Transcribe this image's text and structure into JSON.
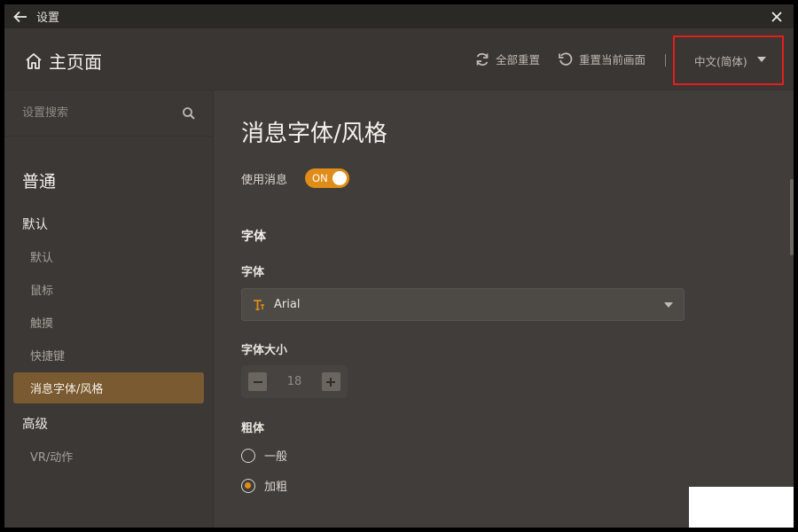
{
  "window": {
    "title": "设置"
  },
  "header": {
    "home_label": "主页面",
    "reset_all_label": "全部重置",
    "reset_page_label": "重置当前画面",
    "language": "中文(简体)"
  },
  "sidebar": {
    "search_placeholder": "设置搜索",
    "general_heading": "普通",
    "default_heading": "默认",
    "items": [
      {
        "label": "默认"
      },
      {
        "label": "鼠标"
      },
      {
        "label": "触摸"
      },
      {
        "label": "快捷键"
      },
      {
        "label": "消息字体/风格",
        "active": true
      }
    ],
    "advanced_heading": "高级",
    "advanced_items": [
      {
        "label": "VR/动作"
      }
    ]
  },
  "main": {
    "title": "消息字体/风格",
    "use_message_label": "使用消息",
    "toggle_state": "ON",
    "section_font": "字体",
    "font_label": "字体",
    "font_value": "Arial",
    "font_size_label": "字体大小",
    "font_size_value": "18",
    "bold_label": "粗体",
    "bold_options": [
      {
        "label": "一般",
        "checked": false
      },
      {
        "label": "加粗",
        "checked": true
      }
    ]
  },
  "colors": {
    "accent": "#e08c18",
    "active_item": "#7a5a30",
    "highlight_border": "#e41e1e"
  }
}
